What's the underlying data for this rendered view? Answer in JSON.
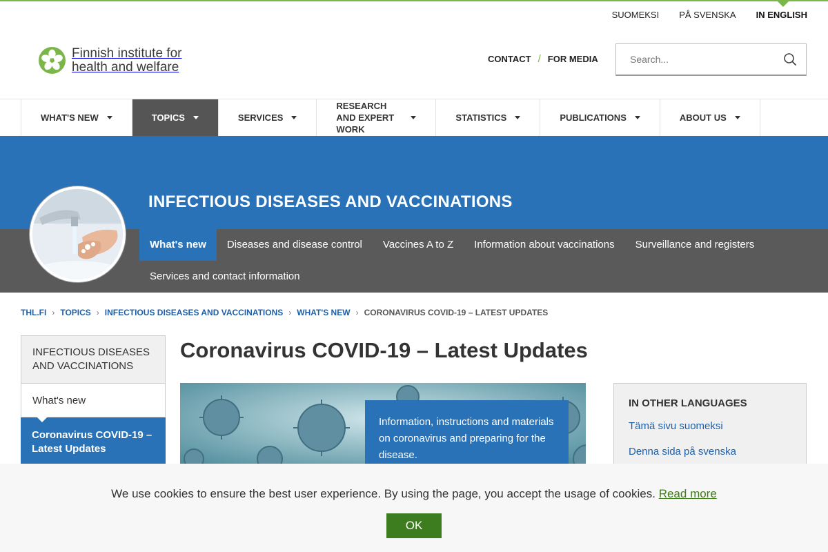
{
  "languages": [
    {
      "label": "SUOMEKSI"
    },
    {
      "label": "PÅ SVENSKA"
    },
    {
      "label": "IN ENGLISH"
    }
  ],
  "logo": {
    "line1": "Finnish institute for",
    "line2": "health and welfare"
  },
  "header_links": {
    "contact": "CONTACT",
    "media": "FOR MEDIA",
    "separator": "/"
  },
  "search": {
    "placeholder": "Search..."
  },
  "main_nav": [
    {
      "label": "WHAT'S NEW"
    },
    {
      "label": "TOPICS"
    },
    {
      "label": "SERVICES"
    },
    {
      "label": "RESEARCH AND EXPERT WORK"
    },
    {
      "label": "STATISTICS"
    },
    {
      "label": "PUBLICATIONS"
    },
    {
      "label": "ABOUT US"
    }
  ],
  "section_title": "INFECTIOUS DISEASES AND VACCINATIONS",
  "sub_nav": [
    {
      "label": "What's new"
    },
    {
      "label": "Diseases and disease control"
    },
    {
      "label": "Vaccines A to Z"
    },
    {
      "label": "Information about vaccinations"
    },
    {
      "label": "Surveillance and registers"
    },
    {
      "label": "Services and contact information"
    }
  ],
  "breadcrumbs": [
    {
      "label": "THL.FI"
    },
    {
      "label": "TOPICS"
    },
    {
      "label": "INFECTIOUS DISEASES AND VACCINATIONS"
    },
    {
      "label": "WHAT'S NEW"
    },
    {
      "label": "CORONAVIRUS COVID-19 – LATEST UPDATES"
    }
  ],
  "side_nav": {
    "heading": "INFECTIOUS DISEASES AND VACCINATIONS",
    "item": "What's new",
    "active": "Coronavirus COVID-19 – Latest Updates"
  },
  "page_title": "Coronavirus COVID-19 – Latest Updates",
  "lead_text": "Information, instructions and materials on coronavirus and preparing for the disease.",
  "other_languages": {
    "heading": "IN OTHER LANGUAGES",
    "links": [
      {
        "label": "Tämä sivu suomeksi"
      },
      {
        "label": "Denna sida på svenska"
      }
    ]
  },
  "cookie": {
    "text": "We use cookies to ensure the best user experience. By using the page, you accept the usage of cookies.",
    "link": "Read more",
    "ok": "OK"
  },
  "colors": {
    "brand_green": "#7ab648",
    "brand_blue": "#2972b8",
    "nav_grey": "#5a5a5a"
  }
}
